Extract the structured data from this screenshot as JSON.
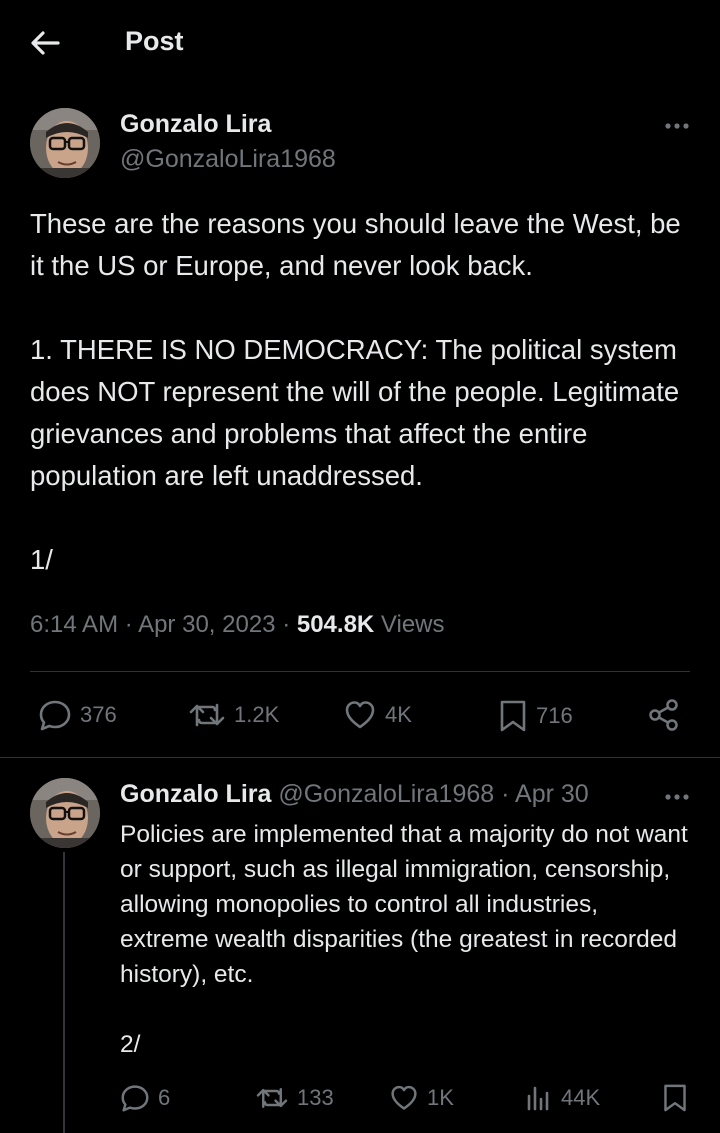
{
  "header": {
    "title": "Post"
  },
  "main_post": {
    "author_name": "Gonzalo Lira",
    "author_handle": "@GonzaloLira1968",
    "text": [
      "These are the reasons you should leave the West, be it the US or Europe, and never look back.",
      "1. THERE IS NO DEMOCRACY: The political system does NOT represent the will of the people. Legitimate grievances and problems that affect the entire population are left unaddressed.",
      "1/"
    ],
    "time": "6:14 AM",
    "date": "Apr 30, 2023",
    "views_count": "504.8K",
    "views_label": "Views",
    "actions": {
      "replies": "376",
      "reposts": "1.2K",
      "likes": "4K",
      "bookmarks": "716"
    }
  },
  "reply_post": {
    "author_name": "Gonzalo Lira",
    "author_handle": "@GonzaloLira1968",
    "date": "Apr 30",
    "text": [
      "Policies are implemented that a majority do not want or support, such as illegal immigration, censorship, allowing monopolies to control all industries, extreme wealth disparities (the greatest in recorded history), etc.",
      "2/"
    ],
    "actions": {
      "replies": "6",
      "reposts": "133",
      "likes": "1K",
      "views": "44K"
    }
  },
  "colors": {
    "background": "#000000",
    "text": "#e7e9ea",
    "muted": "#71767b",
    "divider": "#2f3336"
  }
}
